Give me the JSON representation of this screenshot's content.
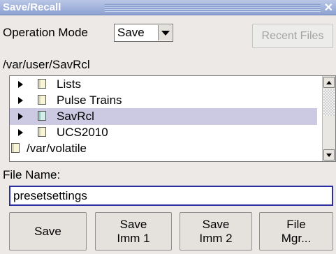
{
  "window": {
    "title": "Save/Recall",
    "close_icon": "close-icon"
  },
  "operation_mode": {
    "label": "Operation Mode",
    "value": "Save"
  },
  "recent_files_label": "Recent Files",
  "path": "/var/user/SavRcl",
  "tree": {
    "items": [
      {
        "label": "Lists",
        "selected": false
      },
      {
        "label": "Pulse Trains",
        "selected": false
      },
      {
        "label": "SavRcl",
        "selected": true
      },
      {
        "label": "UCS2010",
        "selected": false
      },
      {
        "label": "/var/volatile",
        "selected": false
      }
    ]
  },
  "file_name": {
    "label": "File Name:",
    "value": "presetsettings"
  },
  "buttons": {
    "save": "Save",
    "save_imm1_line1": "Save",
    "save_imm1_line2": "Imm 1",
    "save_imm2_line1": "Save",
    "save_imm2_line2": "Imm 2",
    "file_mgr_line1": "File",
    "file_mgr_line2": "Mgr..."
  },
  "colors": {
    "title_bar": "#8ea2d2",
    "selection": "#ccc9e3",
    "input_focus_border": "#2b2fa2",
    "disabled_text": "#a4a4a4"
  }
}
